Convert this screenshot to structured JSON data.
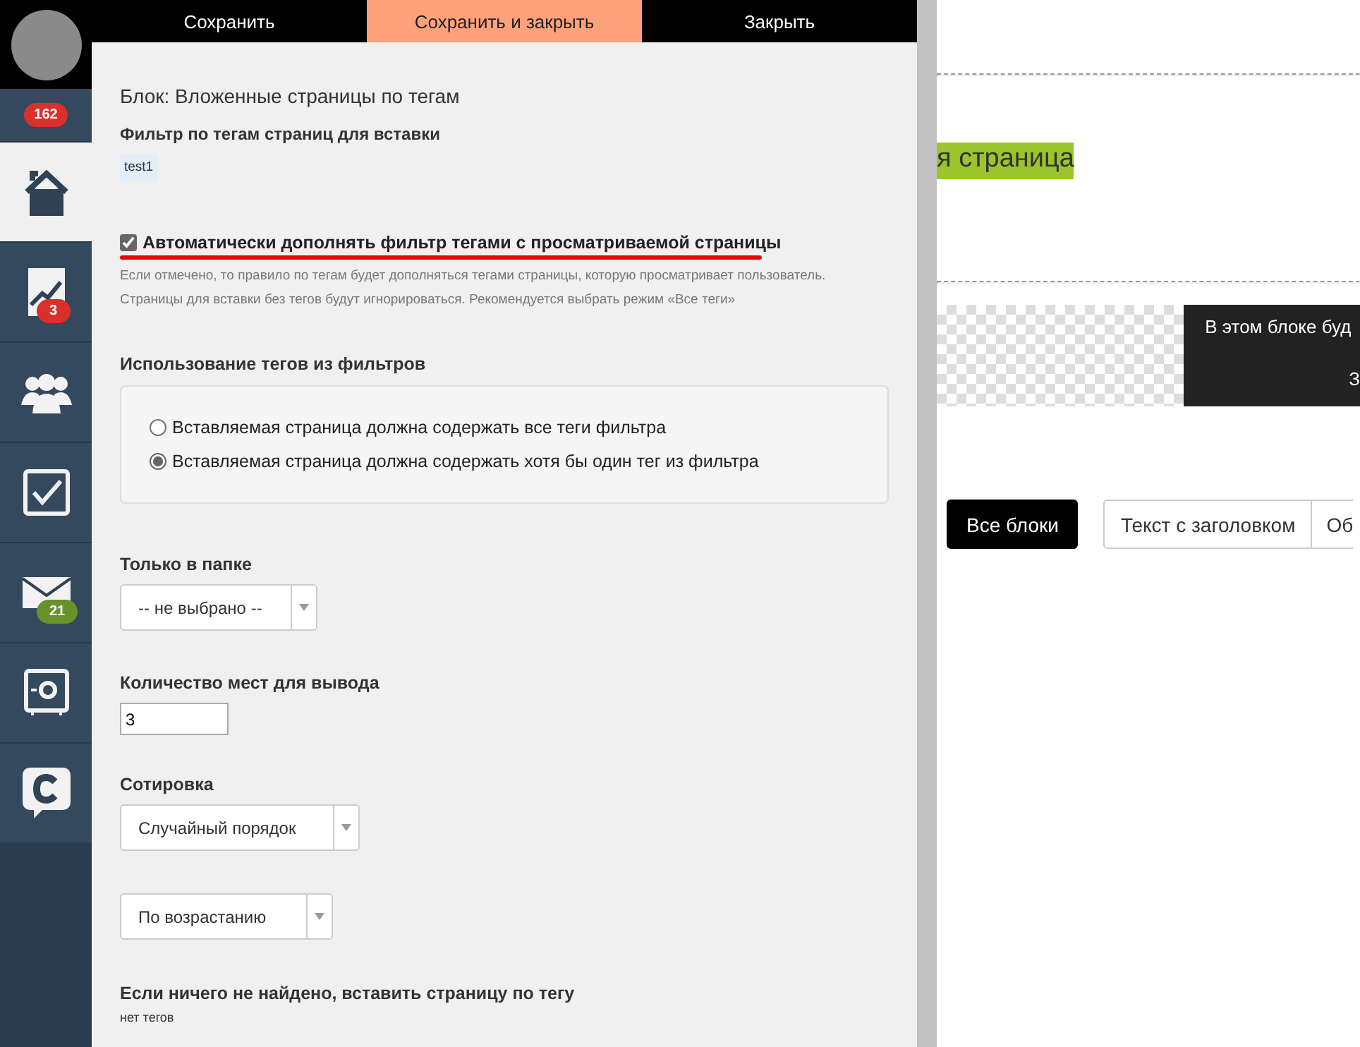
{
  "sidebar": {
    "notification_count": "162",
    "items": [
      {
        "kind": "home",
        "selected": true
      },
      {
        "kind": "chart",
        "selected": false,
        "badge": "3",
        "color": "#d9302c"
      },
      {
        "kind": "users",
        "selected": false
      },
      {
        "kind": "tasks",
        "selected": false
      },
      {
        "kind": "mail",
        "selected": false,
        "badge": "21",
        "color": "#6a922a"
      },
      {
        "kind": "safe",
        "selected": false
      },
      {
        "kind": "chat",
        "selected": false
      }
    ]
  },
  "toolbar": {
    "buttons": [
      {
        "label": "Сохранить",
        "primary": false
      },
      {
        "label": "Сохранить и закрыть",
        "primary": true
      },
      {
        "label": "Закрыть",
        "primary": false
      }
    ]
  },
  "form": {
    "title": "Блок: Вложенные страницы по тегам",
    "filter_label": "Фильтр по тегам страниц для вставки",
    "tags": [
      "test1"
    ],
    "auto_fill": {
      "label": "Автоматически дополнять фильтр тегами с просматриваемой страницы",
      "checked": true
    },
    "hint": [
      "Если отмечено, то правило по тегам будет дополняться тегами страницы, которую просматривает пользователь.",
      "Страницы для вставки без тегов будут игнорироваться. Рекомендуется выбрать режим «Все теги»"
    ],
    "tag_usage": {
      "label": "Использование тегов из фильтров",
      "options": [
        {
          "label": "Вставляемая страница должна содержать все теги фильтра",
          "selected": false
        },
        {
          "label": "Вставляемая страница должна содержать хотя бы один тег из фильтра",
          "selected": true
        }
      ]
    },
    "folder": {
      "label": "Только в папке",
      "value": "-- не выбрано --"
    },
    "count": {
      "label": "Количество мест для вывода",
      "value": "3"
    },
    "sorting": {
      "label": "Сотировка",
      "order": "Случайный порядок",
      "direction": "По возрастанию"
    },
    "fallback": {
      "label": "Если ничего не найдено, вставить страницу по тегу",
      "value": "нет тегов"
    }
  },
  "preview": {
    "heading": "я страница",
    "banner_lines": [
      "В этом блоке буд",
      "З"
    ],
    "filters": [
      {
        "label": "Все блоки",
        "selected": true
      },
      {
        "label": "Текст с заголовком",
        "selected": false
      },
      {
        "label": "Об",
        "selected": false
      }
    ]
  }
}
